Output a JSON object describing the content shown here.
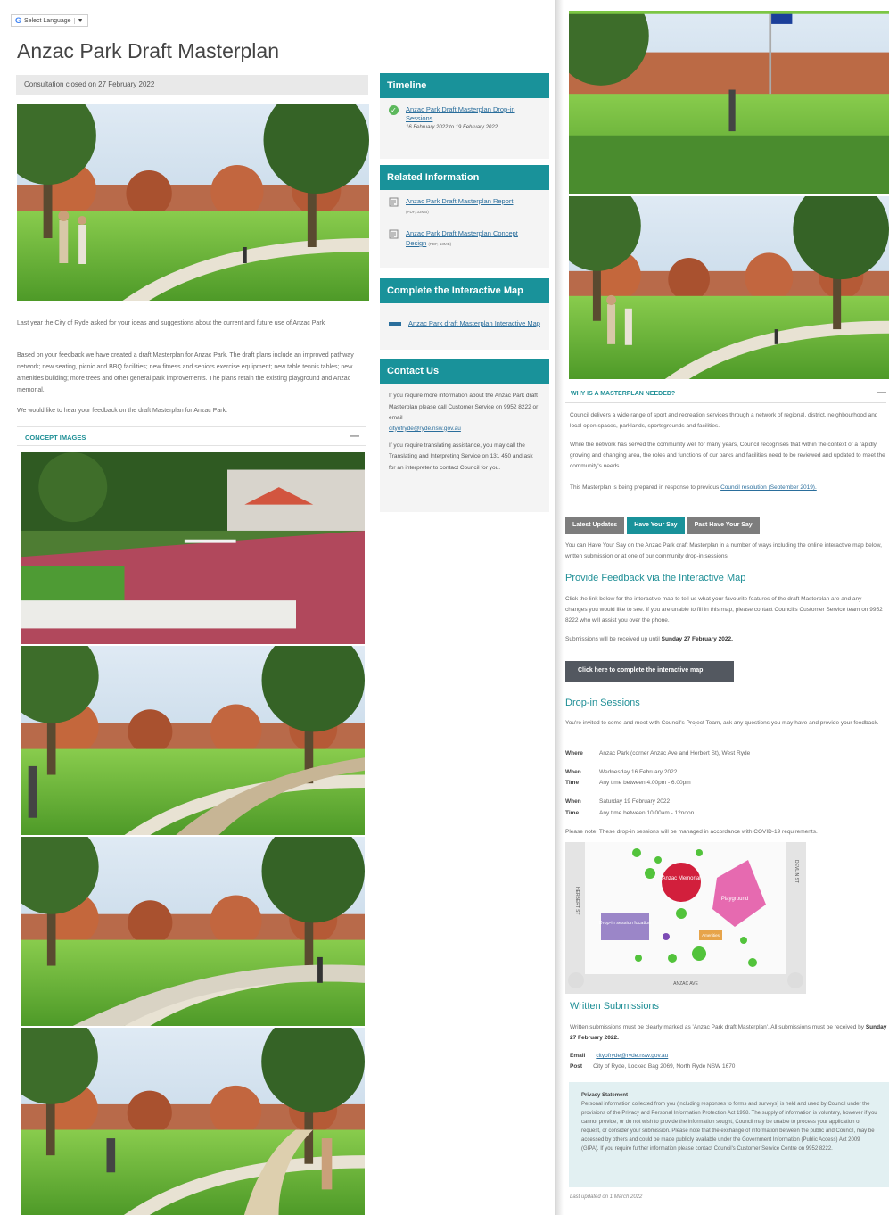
{
  "language_selector": {
    "label": "Select Language",
    "caret": "▼"
  },
  "page_title": "Anzac Park Draft Masterplan",
  "consultation_status": "Consultation closed on 27 February 2022",
  "intro_paragraphs": [
    "Last year the City of Ryde asked for your ideas and suggestions about the current and future use of Anzac Park",
    "Based on your feedback we have created a draft Masterplan for Anzac Park. The draft plans include an improved pathway network; new seating, picnic and BBQ facilities; new fitness and seniors exercise equipment; new table tennis tables; new amenities building; more trees and other general park improvements. The plans retain the existing playground and Anzac memorial.",
    "We would like to hear your feedback on the draft Masterplan for Anzac Park."
  ],
  "concept_images": {
    "heading": "CONCEPT IMAGES",
    "toggle": "—"
  },
  "sidebar": {
    "timeline": {
      "heading": "Timeline",
      "item_link": "Anzac Park Draft Masterplan Drop-in Sessions",
      "item_dates": "16 February 2022 to 19 February 2022"
    },
    "related": {
      "heading": "Related Information",
      "links": [
        {
          "label": "Anzac Park Draft Masterplan Report",
          "size": "(PDF, 33MB)"
        },
        {
          "label": "Anzac Park Draft Masterplan Concept Design",
          "size": "(PDF, 13MB)"
        }
      ]
    },
    "interactive_map": {
      "heading": "Complete the Interactive Map",
      "link": "Anzac Park draft Masterplan Interactive Map"
    },
    "contact": {
      "heading": "Contact Us",
      "text1": "If you require more information about the Anzac Park draft Masterplan please call Customer Service on 9952 8222 or email",
      "email": "cityofryde@ryde.nsw.gov.au",
      "text2": "If you require translating assistance, you may call the Translating and Interpreting Service on 131 450 and ask for an interpreter to contact Council for you."
    }
  },
  "right": {
    "why_heading": "WHY IS A MASTERPLAN NEEDED?",
    "why_toggle": "—",
    "why_p1": "Council delivers a wide range of sport and recreation services through a network of regional, district, neighbourhood and local open spaces, parklands, sportsgrounds and facilities.",
    "why_p2": "While the network has served the community well for many years, Council recognises that within the context of a rapidly growing and changing area, the roles and functions of our parks and facilities need to be reviewed and updated to meet the community's needs.",
    "why_p3": "This Masterplan is being prepared in response to previous",
    "why_link": "Council resolution (September 2019).",
    "tabs": [
      "Latest Updates",
      "Have Your Say",
      "Past Have Your Say"
    ],
    "have_say_intro": "You can Have Your Say on the Anzac Park draft Masterplan in a number of ways including the online interactive map below, written submission or at one of our community drop-in sessions.",
    "feedback_heading": "Provide Feedback via the Interactive Map",
    "feedback_p": "Click the link below for the interactive map to tell us what your favourite features of the draft Masterplan are and any changes you would like to see. If you are unable to fill in this map, please contact Council's Customer Service team on 9952 8222 who will assist you over the phone.",
    "submissions_until": "Submissions will be received up until",
    "submissions_date": "Sunday 27 February 2022.",
    "cta_label": "Click here to complete the interactive map",
    "dropin_heading": "Drop-in Sessions",
    "dropin_p": "You're invited to come and meet with Council's Project Team, ask any questions you may have and provide your feedback.",
    "where_label": "Where",
    "where_value": "Anzac Park (corner Anzac Ave and Herbert St), West Ryde",
    "when_label": "When",
    "time_label": "Time",
    "session1_when": "Wednesday 16 February 2022",
    "session1_time": "Any time between 4.00pm - 6.00pm",
    "session2_when": "Saturday 19 February 2022",
    "session2_time": "Any time between 10.00am - 12noon",
    "covid_note": "Please note: These drop-in sessions will be managed in accordance with COVID-19 requirements.",
    "map_labels": {
      "street_left": "HERBERT ST",
      "street_right": "DEVLIN ST",
      "street_bottom": "ANZAC AVE",
      "memorial": "Anzac Memorial",
      "playground": "Playground",
      "dropin": "Drop-in session location",
      "amenities": "Amenities"
    },
    "written_heading": "Written Submissions",
    "written_p": "Written submissions must be clearly marked as 'Anzac Park draft Masterplan'. All submissions must be received by",
    "written_date": "Sunday 27 February 2022.",
    "email_label": "Email",
    "email_value": "cityofryde@ryde.nsw.gov.au",
    "post_label": "Post",
    "post_value": "City of Ryde, Locked Bag 2069, North Ryde NSW 1670",
    "privacy_heading": "Privacy Statement",
    "privacy_text": "Personal information collected from you (including responses to forms and surveys) is held and used by Council under the provisions of the Privacy and Personal Information Protection Act 1998. The supply of information is voluntary, however if you cannot provide, or do not wish to provide the information sought, Council may be unable to process your application or request, or consider your submission. Please note that the exchange of information between the public and Council, may be accessed by others and could be made publicly available under the Government Information (Public Access) Act 2009 (GIPA). If you require further information please contact Council's Customer Service Centre on 9952 8222.",
    "last_updated": "Last updated on 1 March 2022"
  },
  "colors": {
    "teal": "#19929a",
    "link": "#2a6e9c",
    "grass": "#7cc644",
    "tree": "#3d6d2a",
    "sky": "#cfe3f3"
  }
}
